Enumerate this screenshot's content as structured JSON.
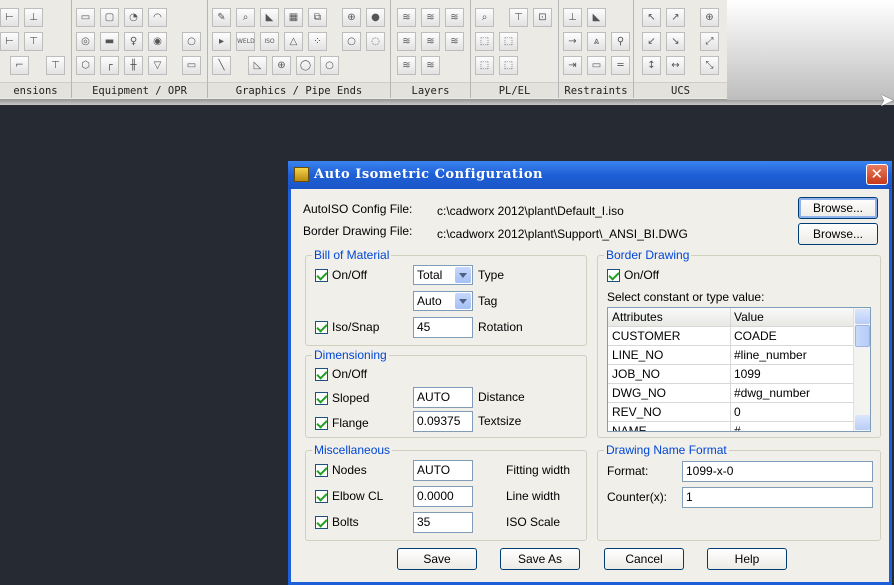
{
  "ribbon": {
    "panels": [
      {
        "title": "ensions"
      },
      {
        "title": "Equipment / OPR"
      },
      {
        "title": "Graphics / Pipe Ends"
      },
      {
        "title": "Layers"
      },
      {
        "title": "PL/EL"
      },
      {
        "title": "Restraints"
      },
      {
        "title": "UCS"
      }
    ],
    "tool_labels": {
      "weld": "WELD",
      "iso": "ISO"
    }
  },
  "dialog": {
    "title": "Auto Isometric Configuration",
    "close_symbol": "✕",
    "config_file_label": "AutoISO Config File:",
    "config_file_value": "c:\\cadworx 2012\\plant\\Default_I.iso",
    "border_file_label": "Border Drawing File:",
    "border_file_value": "c:\\cadworx 2012\\plant\\Support\\_ANSI_BI.DWG",
    "browse_label": "Browse...",
    "bom": {
      "title": "Bill of Material",
      "onoff_label": "On/Off",
      "type_value": "Total",
      "type_label": "Type",
      "tag_value": "Auto",
      "tag_label": "Tag",
      "isosnap_label": "Iso/Snap",
      "rotation_value": "45",
      "rotation_label": "Rotation"
    },
    "dimensioning": {
      "title": "Dimensioning",
      "onoff_label": "On/Off",
      "sloped_label": "Sloped",
      "distance_value": "AUTO",
      "distance_label": "Distance",
      "flange_label": "Flange",
      "textsize_value": "0.09375",
      "textsize_label": "Textsize"
    },
    "misc": {
      "title": "Miscellaneous",
      "nodes_label": "Nodes",
      "fitting_value": "AUTO",
      "fitting_label": "Fitting width",
      "elbow_label": "Elbow CL",
      "linewidth_value": "0.0000",
      "linewidth_label": "Line width",
      "bolts_label": "Bolts",
      "isoscale_value": "35",
      "isoscale_label": "ISO Scale"
    },
    "border": {
      "title": "Border Drawing",
      "onoff_label": "On/Off",
      "select_label": "Select constant or type value:",
      "col_attr": "Attributes",
      "col_value": "Value",
      "rows": [
        {
          "attr": "CUSTOMER",
          "value": "COADE"
        },
        {
          "attr": "LINE_NO",
          "value": "#line_number"
        },
        {
          "attr": "JOB_NO",
          "value": "1099"
        },
        {
          "attr": "DWG_NO",
          "value": "#dwg_number"
        },
        {
          "attr": "REV_NO",
          "value": "0"
        },
        {
          "attr": "NAME",
          "value": "#"
        }
      ]
    },
    "drawing_name": {
      "title": "Drawing Name Format",
      "format_label": "Format:",
      "format_value": "1099-x-0",
      "counter_label": "Counter(x):",
      "counter_value": "1"
    },
    "buttons": {
      "save": "Save",
      "save_as": "Save As",
      "cancel": "Cancel",
      "help": "Help"
    }
  }
}
